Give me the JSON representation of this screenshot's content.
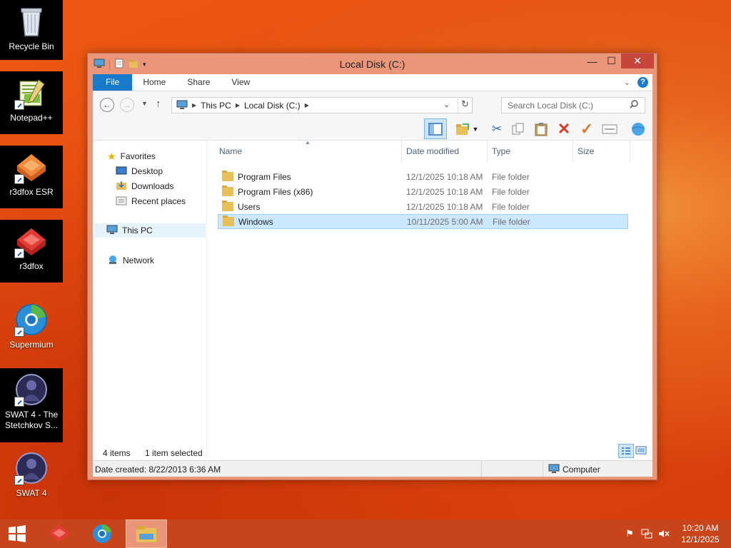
{
  "desktop": {
    "icons": [
      {
        "label": "Recycle Bin"
      },
      {
        "label": "Notepad++"
      },
      {
        "label": "r3dfox ESR"
      },
      {
        "label": "r3dfox"
      },
      {
        "label": "Supermium"
      },
      {
        "label": "SWAT 4 - The Stetchkov S..."
      },
      {
        "label": "SWAT 4"
      }
    ]
  },
  "window": {
    "title": "Local Disk (C:)",
    "ribbon_tabs": [
      "File",
      "Home",
      "Share",
      "View"
    ],
    "breadcrumb": [
      "This PC",
      "Local Disk (C:)"
    ],
    "search_placeholder": "Search Local Disk (C:)",
    "nav": {
      "favorites": "Favorites",
      "desktop": "Desktop",
      "downloads": "Downloads",
      "recent": "Recent places",
      "thispc": "This PC",
      "network": "Network"
    },
    "columns": {
      "name": "Name",
      "date": "Date modified",
      "type": "Type",
      "size": "Size"
    },
    "files": [
      {
        "name": "Program Files",
        "date": "12/1/2025 10:18 AM",
        "type": "File folder"
      },
      {
        "name": "Program Files (x86)",
        "date": "12/1/2025 10:18 AM",
        "type": "File folder"
      },
      {
        "name": "Users",
        "date": "12/1/2025 10:18 AM",
        "type": "File folder"
      },
      {
        "name": "Windows",
        "date": "10/11/2025 5:00 AM",
        "type": "File folder"
      }
    ],
    "status": {
      "count": "4 items",
      "selected": "1 item selected"
    },
    "details": {
      "created": "Date created: 8/22/2013 6:36 AM",
      "location": "Computer"
    }
  },
  "taskbar": {
    "time": "10:20 AM",
    "date": "12/1/2025"
  },
  "colors": {
    "accent": "#1979ca",
    "window_frame": "#e9967a",
    "close": "#c7463c",
    "taskbar": "#c8441a"
  }
}
